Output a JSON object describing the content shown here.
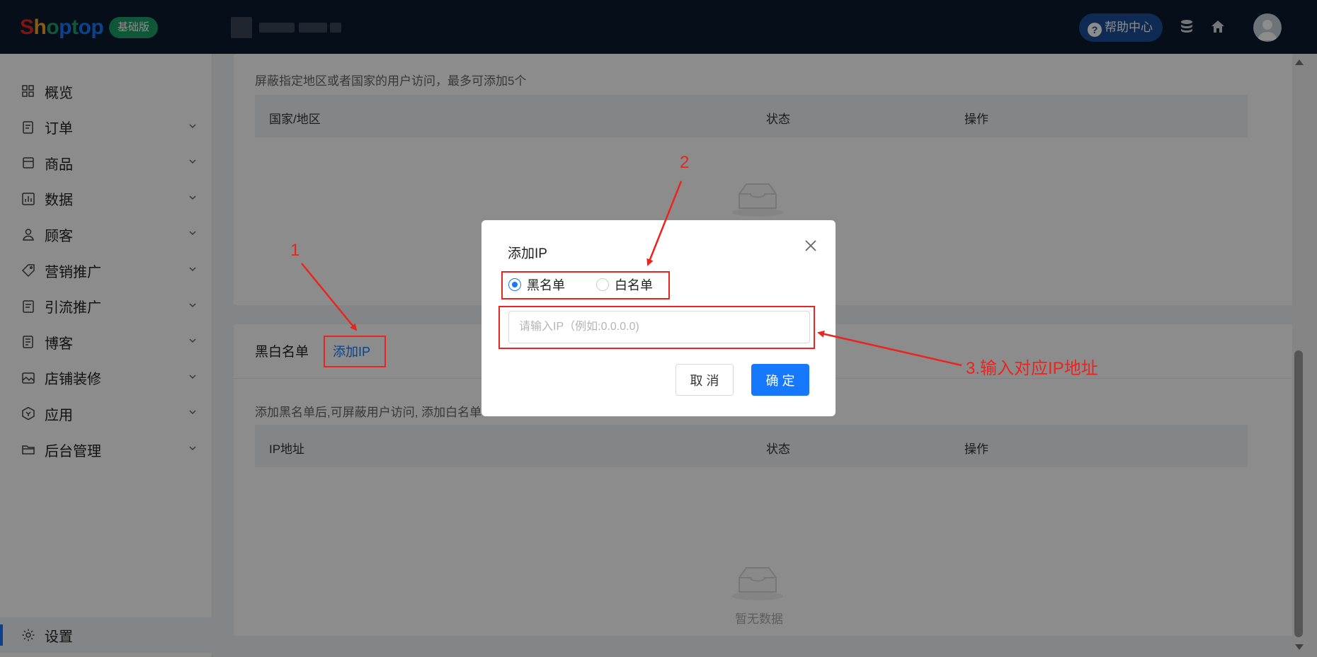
{
  "header": {
    "logo_text": "Shoptop",
    "logo_letters": [
      "S",
      "h",
      "o",
      "p",
      "t",
      "o",
      "p"
    ],
    "logo_colors": [
      "#e8251f",
      "#f5a623",
      "#1e9e6a",
      "#1677ff",
      "#1e9e6a",
      "#1677ff",
      "#1677ff"
    ],
    "plan_badge": "基础版",
    "help_label": "帮助中心",
    "help_icon_glyph": "?"
  },
  "sidebar": {
    "items": [
      {
        "label": "概览",
        "icon": "dashboard-icon",
        "has_children": false
      },
      {
        "label": "订单",
        "icon": "order-icon",
        "has_children": true
      },
      {
        "label": "商品",
        "icon": "product-icon",
        "has_children": true
      },
      {
        "label": "数据",
        "icon": "chart-icon",
        "has_children": true
      },
      {
        "label": "顾客",
        "icon": "user-icon",
        "has_children": true
      },
      {
        "label": "营销推广",
        "icon": "tag-icon",
        "has_children": true
      },
      {
        "label": "引流推广",
        "icon": "document-icon",
        "has_children": true
      },
      {
        "label": "博客",
        "icon": "blog-icon",
        "has_children": true
      },
      {
        "label": "店铺装修",
        "icon": "image-icon",
        "has_children": true
      },
      {
        "label": "应用",
        "icon": "app-icon",
        "has_children": true
      },
      {
        "label": "后台管理",
        "icon": "folder-icon",
        "has_children": true
      }
    ],
    "settings_label": "设置",
    "active": "设置"
  },
  "region_block": {
    "description": "屏蔽指定地区或者国家的用户访问，最多可添加5个",
    "columns": [
      "国家/地区",
      "状态",
      "操作"
    ]
  },
  "blackwhite_block": {
    "title": "黑白名单",
    "add_link": "添加IP",
    "description": "添加黑名单后,可屏蔽用户访问, 添加白名单",
    "columns": [
      "IP地址",
      "状态",
      "操作"
    ],
    "empty_text": "暂无数据"
  },
  "modal": {
    "title": "添加IP",
    "radio_options": [
      "黑名单",
      "白名单"
    ],
    "selected": "黑名单",
    "ip_placeholder": "请输入IP（例如:0.0.0.0)",
    "ip_value": "",
    "cancel_label": "取 消",
    "ok_label": "确 定"
  },
  "annotations": {
    "step1": "1",
    "step2": "2",
    "step3": "3.输入对应IP地址",
    "color": "#e8251f"
  },
  "colors": {
    "primary": "#1677ff",
    "topbar": "#0b1a2e",
    "badge": "#1e9e6a"
  }
}
